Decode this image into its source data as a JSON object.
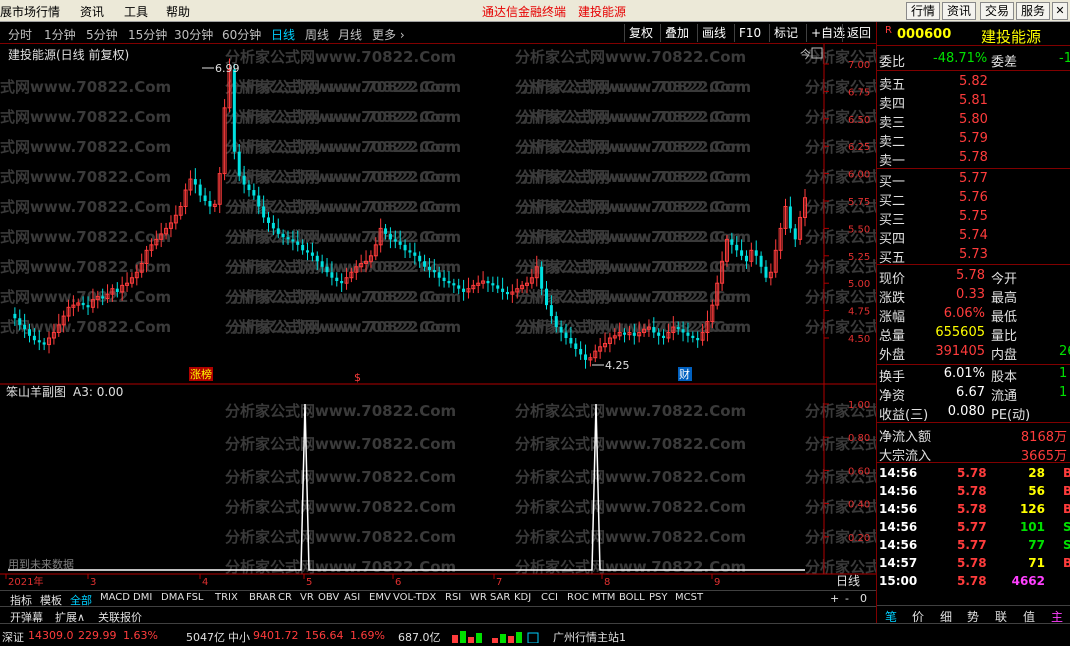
{
  "menubar": {
    "items": [
      "展市场行情",
      "资讯",
      "工具",
      "帮助"
    ],
    "brand": "通达信金融终端",
    "stock_name": "建投能源",
    "right_buttons": [
      "行情",
      "资讯",
      "交易",
      "服务"
    ]
  },
  "periods": [
    "分时",
    "1分钟",
    "5分钟",
    "15分钟",
    "30分钟",
    "60分钟",
    "日线",
    "周线",
    "月线",
    "更多 ›"
  ],
  "active_period": "日线",
  "toolbar_buttons": [
    "复权",
    "叠加",
    "画线",
    "F10",
    "标记",
    "+自选",
    "返回"
  ],
  "main_chart": {
    "title": "建投能源(日线 前复权)",
    "price_ticks": [
      "7.00",
      "6.75",
      "6.50",
      "6.25",
      "6.00",
      "5.75",
      "5.50",
      "5.25",
      "5.00",
      "4.75",
      "4.50"
    ],
    "high_label": "6.99",
    "low_label": "4.25",
    "markers": [
      "涨榜",
      "$",
      "财"
    ],
    "corner_icon": "今",
    "watermark": "分析家公式网www.70822.Com"
  },
  "sub_chart": {
    "title": "笨山羊副图",
    "value_label": "A3: 0.00",
    "ticks": [
      "1.00",
      "0.80",
      "0.60",
      "0.40",
      "0.20"
    ],
    "note": "用到未来数据"
  },
  "x_axis": {
    "labels": [
      "2021年",
      "3",
      "4",
      "5",
      "6",
      "7",
      "8",
      "9"
    ],
    "period_label": "日线"
  },
  "chart_data": {
    "type": "candlestick",
    "ylim": [
      4.2,
      7.05
    ],
    "high": 6.99,
    "low": 4.25,
    "sub_indicator": {
      "ylim": [
        0,
        1.0
      ],
      "spikes_at_x": [
        "5",
        "8"
      ],
      "spike_value": 1.0
    }
  },
  "indicator_tabs": {
    "items": [
      "指标",
      "模板",
      "全部",
      "MACD",
      "DMI",
      "DMA",
      "FSL",
      "TRIX",
      "BRAR",
      "CR",
      "VR",
      "OBV",
      "ASI",
      "EMV",
      "VOL-TDX",
      "RSI",
      "WR",
      "SAR",
      "KDJ",
      "CCI",
      "ROC",
      "MTM",
      "BOLL",
      "PSY",
      "MCST"
    ],
    "active": "全部",
    "right_controls": [
      "+",
      "-",
      "0"
    ]
  },
  "tabs_row2": [
    "开弹幕",
    "扩展∧",
    "关联报价"
  ],
  "status_bar": {
    "sz_label": "深证",
    "sz_value": "14309.0",
    "sz_change": "229.99",
    "sz_pct": "1.63%",
    "sz_amount": "5047亿",
    "zx_label": "中小",
    "zx_value": "9401.72",
    "zx_change": "156.64",
    "zx_pct": "1.69%",
    "zx_amount": "687.0亿",
    "server": "广州行情主站1"
  },
  "panel": {
    "code_marker": "R",
    "code": "000600",
    "name": "建投能源",
    "weibi_label": "委比",
    "weibi_value": "-48.71%",
    "weicha_label": "委差",
    "weicha_value": "-1",
    "sell": [
      {
        "label": "卖五",
        "price": "5.82"
      },
      {
        "label": "卖四",
        "price": "5.81"
      },
      {
        "label": "卖三",
        "price": "5.80"
      },
      {
        "label": "卖二",
        "price": "5.79"
      },
      {
        "label": "卖一",
        "price": "5.78"
      }
    ],
    "buy": [
      {
        "label": "买一",
        "price": "5.77"
      },
      {
        "label": "买二",
        "price": "5.76"
      },
      {
        "label": "买三",
        "price": "5.75"
      },
      {
        "label": "买四",
        "price": "5.74"
      },
      {
        "label": "买五",
        "price": "5.73"
      }
    ],
    "stats": [
      {
        "l1": "现价",
        "v1": "5.78",
        "l2": "今开",
        "v2": ""
      },
      {
        "l1": "涨跌",
        "v1": "0.33",
        "l2": "最高",
        "v2": ""
      },
      {
        "l1": "涨幅",
        "v1": "6.06%",
        "l2": "最低",
        "v2": ""
      },
      {
        "l1": "总量",
        "v1": "655605",
        "l2": "量比",
        "v2": ""
      },
      {
        "l1": "外盘",
        "v1": "391405",
        "l2": "内盘",
        "v2": "26"
      }
    ],
    "stats2": [
      {
        "l1": "换手",
        "v1": "6.01%",
        "l2": "股本",
        "v2": "1"
      },
      {
        "l1": "净资",
        "v1": "6.67",
        "l2": "流通",
        "v2": "1"
      },
      {
        "l1": "收益(三)",
        "v1": "0.080",
        "l2": "PE(动)",
        "v2": ""
      }
    ],
    "flows": [
      {
        "label": "净流入额",
        "value": "8168万"
      },
      {
        "label": "大宗流入",
        "value": "3665万"
      }
    ],
    "ticks": [
      {
        "time": "14:56",
        "price": "5.78",
        "vol": "28",
        "flag": "B"
      },
      {
        "time": "14:56",
        "price": "5.78",
        "vol": "56",
        "flag": "B"
      },
      {
        "time": "14:56",
        "price": "5.78",
        "vol": "126",
        "flag": "B"
      },
      {
        "time": "14:56",
        "price": "5.77",
        "vol": "101",
        "flag": "S"
      },
      {
        "time": "14:56",
        "price": "5.77",
        "vol": "77",
        "flag": "S"
      },
      {
        "time": "14:57",
        "price": "5.78",
        "vol": "71",
        "flag": "B"
      },
      {
        "time": "15:00",
        "price": "5.78",
        "vol": "4662",
        "flag": ""
      }
    ],
    "bottom_tabs": [
      "笔",
      "价",
      "细",
      "势",
      "联",
      "值",
      "主"
    ]
  }
}
